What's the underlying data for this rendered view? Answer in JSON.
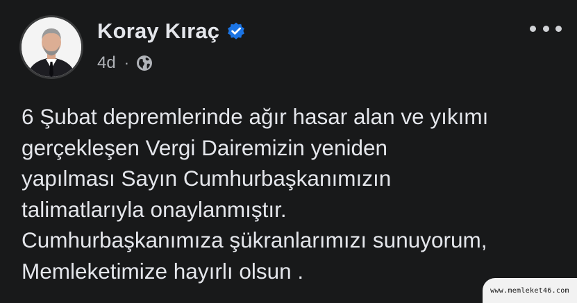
{
  "post": {
    "author": "Koray Kıraç",
    "time": "4d",
    "separator": "·",
    "verified_icon": "verified-badge-icon",
    "privacy_icon": "globe-icon",
    "more_icon": "more-options-icon",
    "body_lines": [
      "6 Şubat depremlerinde ağır hasar alan ve yıkımı",
      "gerçekleşen Vergi Dairemizin yeniden",
      "yapılması Sayın Cumhurbaşkanımızın",
      "talimatlarıyla onaylanmıştır.",
      "Cumhurbaşkanımıza şükranlarımızı sunuyorum,",
      "Memleketimize hayırlı olsun ."
    ]
  },
  "watermark": {
    "text": "www.memleket46.com"
  },
  "colors": {
    "background": "#18191a",
    "primary_text": "#e4e6eb",
    "secondary_text": "#b0b3b8",
    "verified_blue": "#1b74e4"
  }
}
